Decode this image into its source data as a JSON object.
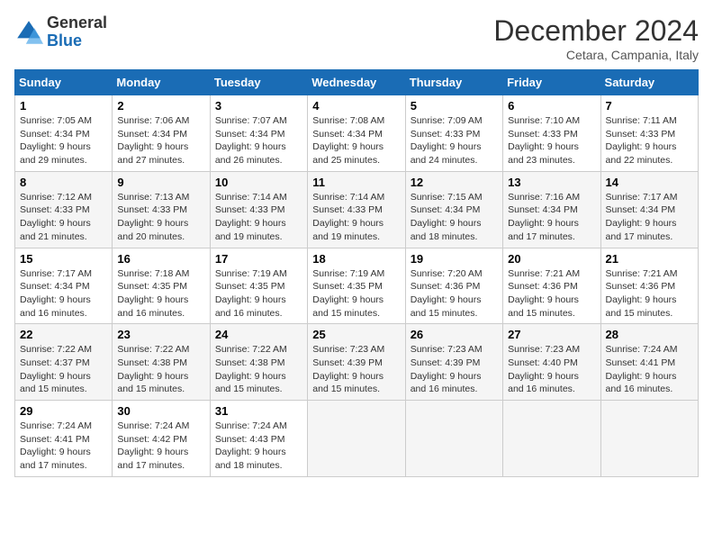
{
  "logo": {
    "general": "General",
    "blue": "Blue"
  },
  "header": {
    "month": "December 2024",
    "location": "Cetara, Campania, Italy"
  },
  "weekdays": [
    "Sunday",
    "Monday",
    "Tuesday",
    "Wednesday",
    "Thursday",
    "Friday",
    "Saturday"
  ],
  "weeks": [
    [
      {
        "day": "1",
        "sunrise": "7:05 AM",
        "sunset": "4:34 PM",
        "daylight": "9 hours and 29 minutes."
      },
      {
        "day": "2",
        "sunrise": "7:06 AM",
        "sunset": "4:34 PM",
        "daylight": "9 hours and 27 minutes."
      },
      {
        "day": "3",
        "sunrise": "7:07 AM",
        "sunset": "4:34 PM",
        "daylight": "9 hours and 26 minutes."
      },
      {
        "day": "4",
        "sunrise": "7:08 AM",
        "sunset": "4:34 PM",
        "daylight": "9 hours and 25 minutes."
      },
      {
        "day": "5",
        "sunrise": "7:09 AM",
        "sunset": "4:33 PM",
        "daylight": "9 hours and 24 minutes."
      },
      {
        "day": "6",
        "sunrise": "7:10 AM",
        "sunset": "4:33 PM",
        "daylight": "9 hours and 23 minutes."
      },
      {
        "day": "7",
        "sunrise": "7:11 AM",
        "sunset": "4:33 PM",
        "daylight": "9 hours and 22 minutes."
      }
    ],
    [
      {
        "day": "8",
        "sunrise": "7:12 AM",
        "sunset": "4:33 PM",
        "daylight": "9 hours and 21 minutes."
      },
      {
        "day": "9",
        "sunrise": "7:13 AM",
        "sunset": "4:33 PM",
        "daylight": "9 hours and 20 minutes."
      },
      {
        "day": "10",
        "sunrise": "7:14 AM",
        "sunset": "4:33 PM",
        "daylight": "9 hours and 19 minutes."
      },
      {
        "day": "11",
        "sunrise": "7:14 AM",
        "sunset": "4:33 PM",
        "daylight": "9 hours and 19 minutes."
      },
      {
        "day": "12",
        "sunrise": "7:15 AM",
        "sunset": "4:34 PM",
        "daylight": "9 hours and 18 minutes."
      },
      {
        "day": "13",
        "sunrise": "7:16 AM",
        "sunset": "4:34 PM",
        "daylight": "9 hours and 17 minutes."
      },
      {
        "day": "14",
        "sunrise": "7:17 AM",
        "sunset": "4:34 PM",
        "daylight": "9 hours and 17 minutes."
      }
    ],
    [
      {
        "day": "15",
        "sunrise": "7:17 AM",
        "sunset": "4:34 PM",
        "daylight": "9 hours and 16 minutes."
      },
      {
        "day": "16",
        "sunrise": "7:18 AM",
        "sunset": "4:35 PM",
        "daylight": "9 hours and 16 minutes."
      },
      {
        "day": "17",
        "sunrise": "7:19 AM",
        "sunset": "4:35 PM",
        "daylight": "9 hours and 16 minutes."
      },
      {
        "day": "18",
        "sunrise": "7:19 AM",
        "sunset": "4:35 PM",
        "daylight": "9 hours and 15 minutes."
      },
      {
        "day": "19",
        "sunrise": "7:20 AM",
        "sunset": "4:36 PM",
        "daylight": "9 hours and 15 minutes."
      },
      {
        "day": "20",
        "sunrise": "7:21 AM",
        "sunset": "4:36 PM",
        "daylight": "9 hours and 15 minutes."
      },
      {
        "day": "21",
        "sunrise": "7:21 AM",
        "sunset": "4:36 PM",
        "daylight": "9 hours and 15 minutes."
      }
    ],
    [
      {
        "day": "22",
        "sunrise": "7:22 AM",
        "sunset": "4:37 PM",
        "daylight": "9 hours and 15 minutes."
      },
      {
        "day": "23",
        "sunrise": "7:22 AM",
        "sunset": "4:38 PM",
        "daylight": "9 hours and 15 minutes."
      },
      {
        "day": "24",
        "sunrise": "7:22 AM",
        "sunset": "4:38 PM",
        "daylight": "9 hours and 15 minutes."
      },
      {
        "day": "25",
        "sunrise": "7:23 AM",
        "sunset": "4:39 PM",
        "daylight": "9 hours and 15 minutes."
      },
      {
        "day": "26",
        "sunrise": "7:23 AM",
        "sunset": "4:39 PM",
        "daylight": "9 hours and 16 minutes."
      },
      {
        "day": "27",
        "sunrise": "7:23 AM",
        "sunset": "4:40 PM",
        "daylight": "9 hours and 16 minutes."
      },
      {
        "day": "28",
        "sunrise": "7:24 AM",
        "sunset": "4:41 PM",
        "daylight": "9 hours and 16 minutes."
      }
    ],
    [
      {
        "day": "29",
        "sunrise": "7:24 AM",
        "sunset": "4:41 PM",
        "daylight": "9 hours and 17 minutes."
      },
      {
        "day": "30",
        "sunrise": "7:24 AM",
        "sunset": "4:42 PM",
        "daylight": "9 hours and 17 minutes."
      },
      {
        "day": "31",
        "sunrise": "7:24 AM",
        "sunset": "4:43 PM",
        "daylight": "9 hours and 18 minutes."
      },
      null,
      null,
      null,
      null
    ]
  ],
  "labels": {
    "sunrise": "Sunrise:",
    "sunset": "Sunset:",
    "daylight": "Daylight:"
  }
}
